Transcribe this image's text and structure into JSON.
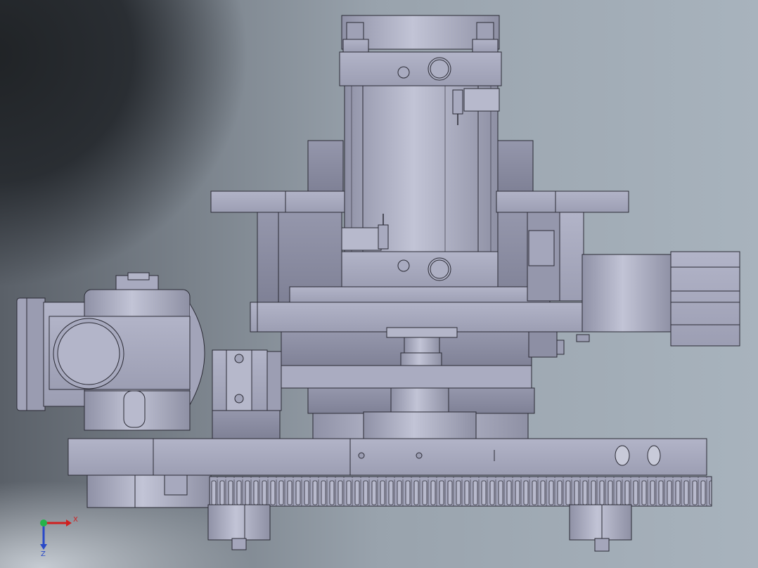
{
  "viewport": {
    "background_light": "#b4bcc6",
    "background_dark": "#24272b",
    "part_color": "#a6a8bd",
    "edge_color": "#2a2a34"
  },
  "triad": {
    "x_label": "X",
    "z_label": "Z",
    "x_color": "#d01f1f",
    "y_color": "#25b34a",
    "z_color": "#2848c8"
  }
}
